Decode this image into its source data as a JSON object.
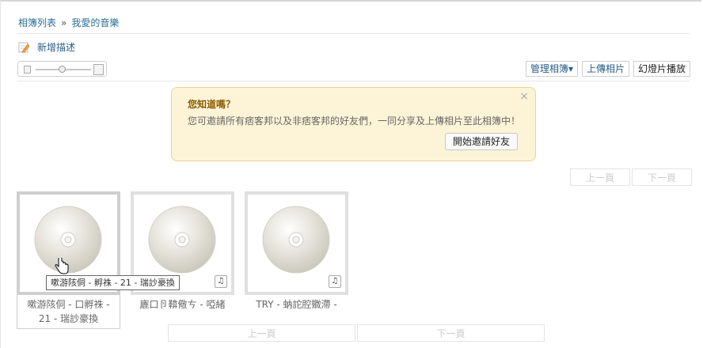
{
  "breadcrumb": {
    "root": "相簿列表",
    "separator": "»",
    "current": "我愛的音樂"
  },
  "actions": {
    "add_description": "新增描述"
  },
  "toolbar": {
    "manage": "管理相簿▾",
    "upload": "上傳相片",
    "slideshow": "幻燈片播放"
  },
  "tip": {
    "title": "您知道嗎？",
    "message": "您可邀請所有痞客邦以及非痞客邦的好友們，一同分享及上傳相片至此相簿中！",
    "close": "×",
    "invite_button": "開始邀請好友"
  },
  "pager": {
    "prev": "上一頁",
    "next": "下一頁"
  },
  "albums": [
    {
      "title_line1": "嗽游陔侗 - 口孵祩 -",
      "title_line2": "21 - 瑞訬豪換"
    },
    {
      "title_line1": "廘口卪鞥儆ㄘ - 啞緒",
      "title_line2": ""
    },
    {
      "title_line1": "TRY - 蚋詑腔覹滯 -",
      "title_line2": ""
    }
  ],
  "tooltip": "嗽游陔侗 -    孵祩 - 21 - 瑞訬豪換",
  "icons": {
    "pencil": "pencil-icon",
    "note": "♫",
    "zoom_small": "thumb-small-icon",
    "zoom_large": "thumb-large-icon"
  },
  "colors": {
    "link": "#2a6f97",
    "tip_bg": "#fdf4d7",
    "tip_border": "#e8d48c",
    "tip_title": "#8a5a00"
  }
}
